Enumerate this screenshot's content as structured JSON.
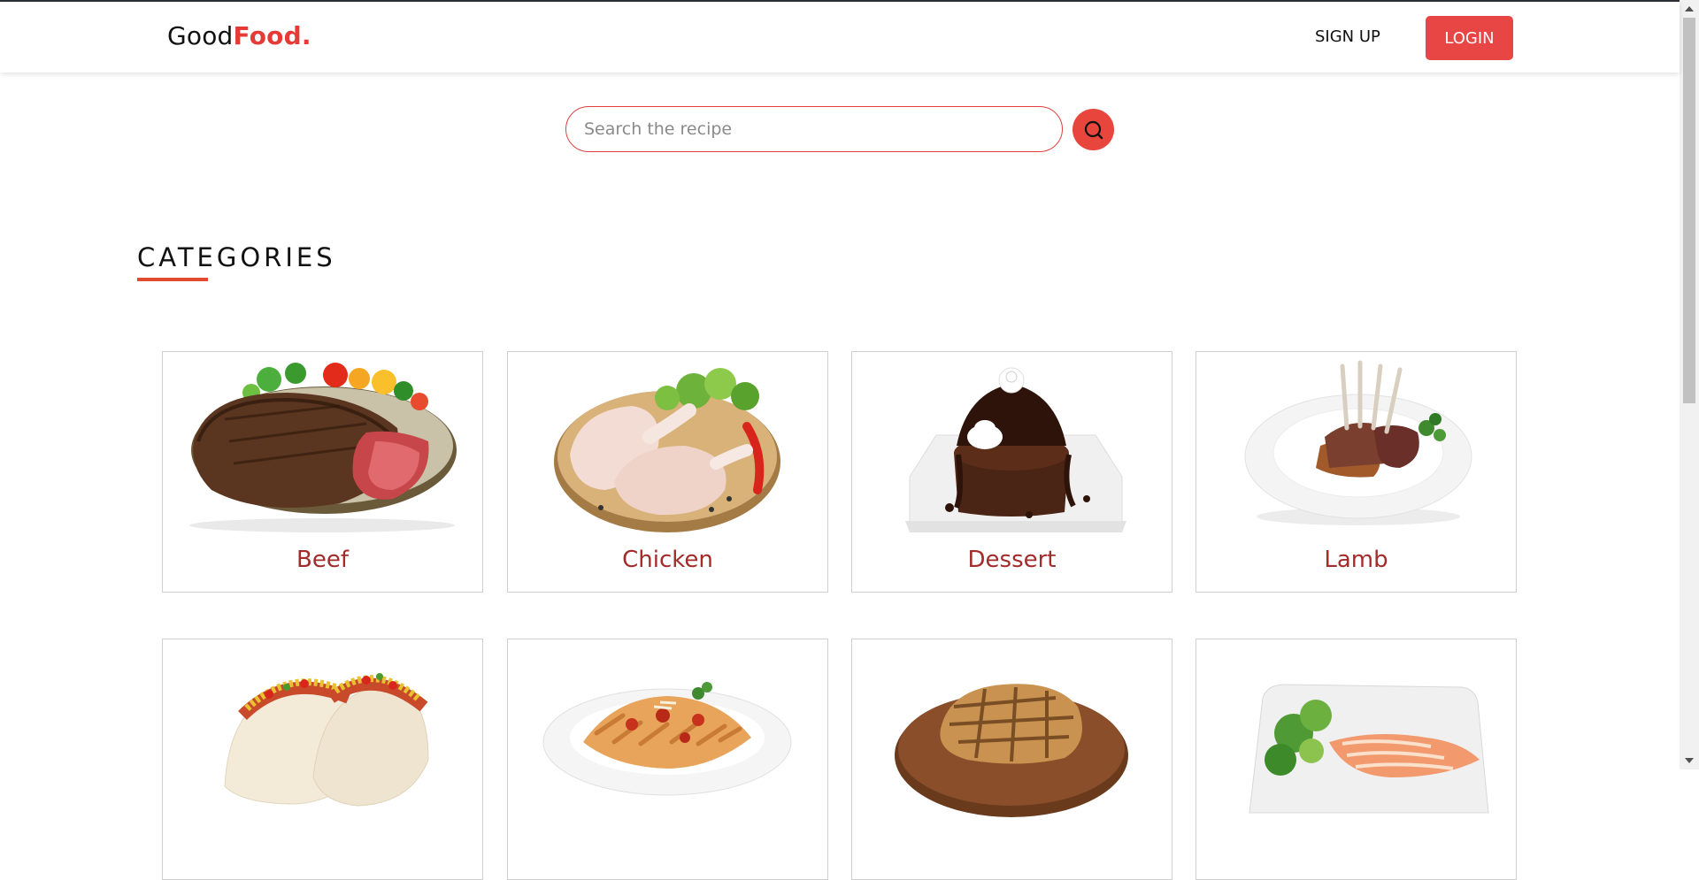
{
  "brand": {
    "part1": "Good",
    "part2": "Food."
  },
  "nav": {
    "signup": "SIGN UP",
    "login": "LOGIN"
  },
  "search": {
    "placeholder": "Search the recipe",
    "value": "",
    "icon": "search-icon"
  },
  "section": {
    "title": "CATEGORIES"
  },
  "categories": [
    {
      "name": "Beef",
      "icon": "steak-image"
    },
    {
      "name": "Chicken",
      "icon": "chicken-legs-image"
    },
    {
      "name": "Dessert",
      "icon": "chocolate-cake-image"
    },
    {
      "name": "Lamb",
      "icon": "lamb-rack-image"
    },
    {
      "name": "",
      "icon": "tacos-image"
    },
    {
      "name": "",
      "icon": "pasta-image"
    },
    {
      "name": "",
      "icon": "pork-chop-image"
    },
    {
      "name": "",
      "icon": "salmon-plate-image"
    }
  ],
  "colors": {
    "accent": "#e84545",
    "label": "#a32b2b",
    "underline": "#e04a2f"
  }
}
